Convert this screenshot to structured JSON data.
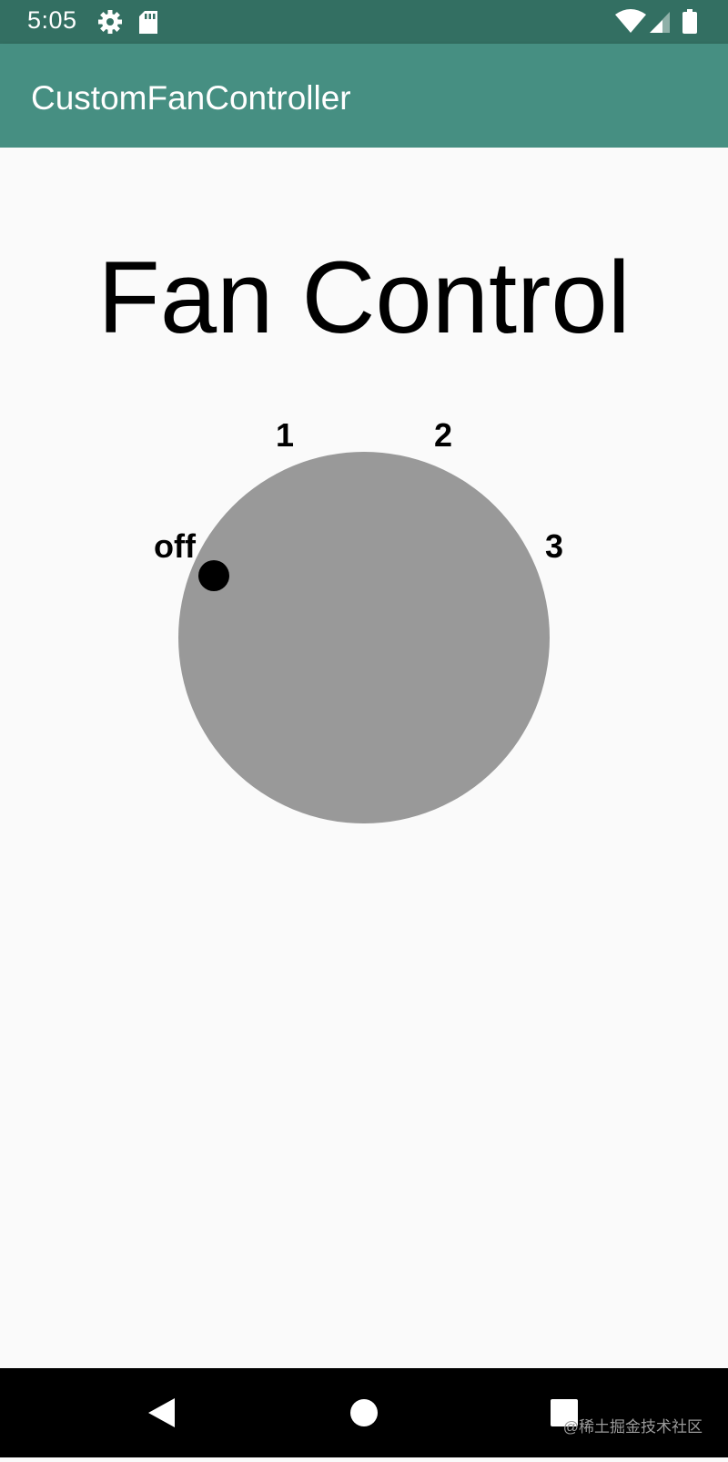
{
  "status_bar": {
    "time": "5:05",
    "left_icons": [
      "settings-icon",
      "sd-card-icon"
    ],
    "right_icons": [
      "wifi-icon",
      "cellular-signal-icon",
      "battery-icon"
    ]
  },
  "app_bar": {
    "title": "CustomFanController",
    "color": "#468f82"
  },
  "main": {
    "heading": "Fan Control",
    "fan_dial": {
      "labels": [
        "off",
        "1",
        "2",
        "3"
      ],
      "selected": "off",
      "dial_color": "#999999",
      "indicator_color": "#000000"
    }
  },
  "nav_bar": {
    "buttons": [
      "back-icon",
      "home-icon",
      "recents-icon"
    ]
  },
  "watermark": "@稀土掘金技术社区"
}
